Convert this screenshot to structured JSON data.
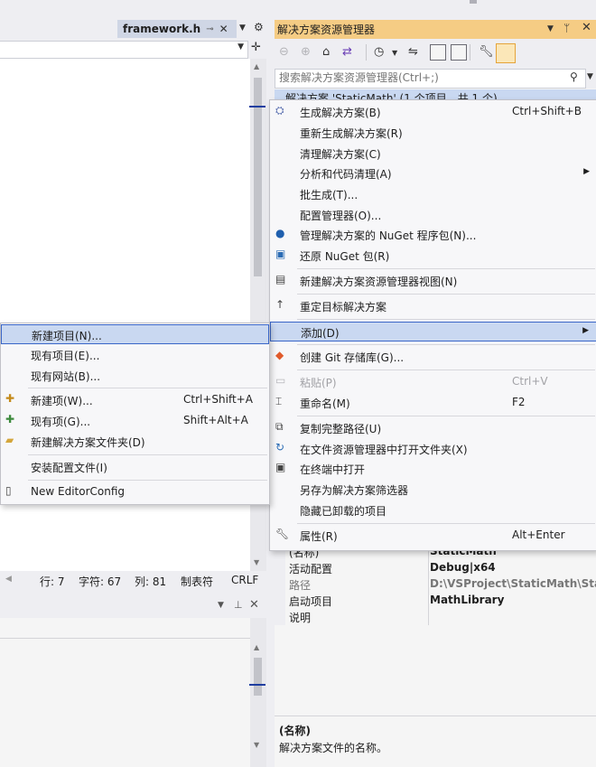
{
  "editor": {
    "tab_title": "framework.h",
    "status": {
      "line": "行: 7",
      "char": "字符: 67",
      "col": "列: 81",
      "tabs": "制表符",
      "eol": "CRLF"
    }
  },
  "solution_explorer": {
    "title": "解决方案资源管理器",
    "search_placeholder": "搜索解决方案资源管理器(Ctrl+;)",
    "solution_node": "解决方案 'StaticMath' (1 个项目，共 1 个)"
  },
  "properties": {
    "rows": [
      {
        "key": "(名称)",
        "value": "StaticMath"
      },
      {
        "key": "活动配置",
        "value": "Debug|x64"
      },
      {
        "key": "路径",
        "value": "D:\\VSProject\\StaticMath\\Static"
      },
      {
        "key": "启动项目",
        "value": "MathLibrary"
      },
      {
        "key": "说明",
        "value": ""
      }
    ],
    "description_name": "(名称)",
    "description_text": "解决方案文件的名称。"
  },
  "context_menu": {
    "items": [
      {
        "label": "生成解决方案(B)",
        "shortcut": "Ctrl+Shift+B",
        "icon": "build-icon"
      },
      {
        "label": "重新生成解决方案(R)",
        "shortcut": ""
      },
      {
        "label": "清理解决方案(C)",
        "shortcut": ""
      },
      {
        "label": "分析和代码清理(A)",
        "shortcut": "",
        "submenu": true
      },
      {
        "label": "批生成(T)...",
        "shortcut": ""
      },
      {
        "label": "配置管理器(O)...",
        "shortcut": ""
      },
      {
        "label": "管理解决方案的 NuGet 程序包(N)...",
        "shortcut": "",
        "icon": "nuget-icon"
      },
      {
        "label": "还原 NuGet 包(R)",
        "shortcut": "",
        "icon": "restore-packages-icon"
      },
      {
        "label": "新建解决方案资源管理器视图(N)",
        "shortcut": "",
        "icon": "new-view-icon"
      },
      {
        "label": "重定目标解决方案",
        "shortcut": "",
        "icon": "retarget-icon"
      },
      {
        "label": "添加(D)",
        "shortcut": "",
        "submenu": true,
        "highlighted": true
      },
      {
        "label": "创建 Git 存储库(G)...",
        "shortcut": "",
        "icon": "git-icon"
      },
      {
        "label": "粘贴(P)",
        "shortcut": "Ctrl+V",
        "disabled": true,
        "icon": "paste-icon"
      },
      {
        "label": "重命名(M)",
        "shortcut": "F2",
        "icon": "rename-icon"
      },
      {
        "label": "复制完整路径(U)",
        "shortcut": "",
        "icon": "copy-path-icon"
      },
      {
        "label": "在文件资源管理器中打开文件夹(X)",
        "shortcut": "",
        "icon": "open-folder-icon"
      },
      {
        "label": "在终端中打开",
        "shortcut": "",
        "icon": "terminal-icon"
      },
      {
        "label": "另存为解决方案筛选器",
        "shortcut": ""
      },
      {
        "label": "隐藏已卸载的项目",
        "shortcut": ""
      },
      {
        "label": "属性(R)",
        "shortcut": "Alt+Enter",
        "icon": "wrench-icon"
      }
    ]
  },
  "add_submenu": {
    "items": [
      {
        "label": "新建项目(N)...",
        "shortcut": "",
        "highlighted": true
      },
      {
        "label": "现有项目(E)...",
        "shortcut": ""
      },
      {
        "label": "现有网站(B)...",
        "shortcut": ""
      },
      {
        "label": "新建项(W)...",
        "shortcut": "Ctrl+Shift+A",
        "icon": "new-item-icon"
      },
      {
        "label": "现有项(G)...",
        "shortcut": "Shift+Alt+A",
        "icon": "existing-item-icon"
      },
      {
        "label": "新建解决方案文件夹(D)",
        "shortcut": "",
        "icon": "solution-folder-icon"
      },
      {
        "label": "安装配置文件(I)",
        "shortcut": ""
      },
      {
        "label": "New EditorConfig",
        "shortcut": "",
        "icon": "editorconfig-icon"
      }
    ]
  }
}
